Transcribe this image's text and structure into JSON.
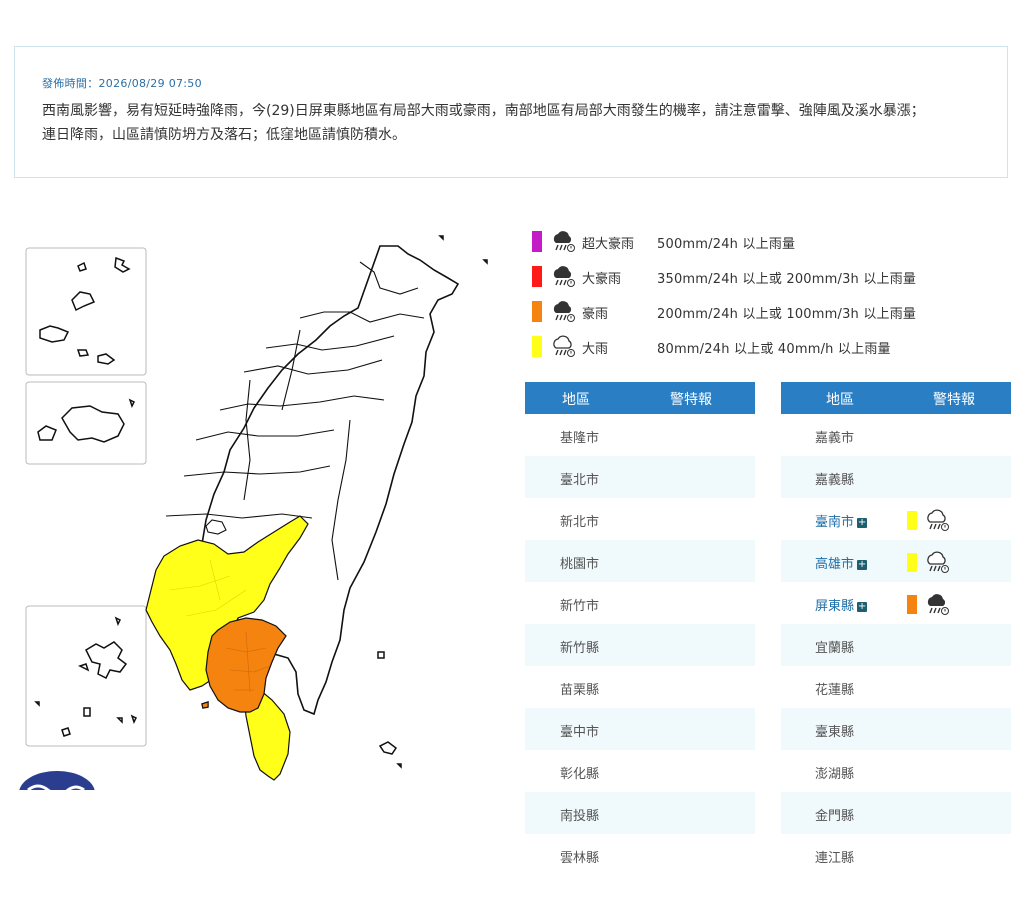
{
  "notice": {
    "time": "發佈時間：2026/08/29 07:50",
    "line1": "西南風影響，易有短延時強降雨，今(29)日屏東縣地區有局部大雨或豪雨，南部地區有局部大雨發生的機率，請注意雷擊、強陣風及溪水暴漲；",
    "line2": "連日降雨，山區請慎防坍方及落石；低窪地區請慎防積水。"
  },
  "colors": {
    "extreme": "#c21bc7",
    "torrential": "#ff1a1a",
    "heavy_torrential": "#f5830f",
    "heavy": "#ffff1a",
    "header": "#2a7fc4",
    "alt_row": "#f0f9fc"
  },
  "legend": [
    {
      "name": "超大豪雨",
      "desc": "500mm/24h 以上雨量",
      "color": "#c21bc7",
      "icon": "storm-rain-dark-icon"
    },
    {
      "name": "大豪雨",
      "desc": "350mm/24h 以上或 200mm/3h 以上雨量",
      "color": "#ff1a1a",
      "icon": "storm-rain-dark-icon"
    },
    {
      "name": "豪雨",
      "desc": "200mm/24h 以上或 100mm/3h 以上雨量",
      "color": "#f5830f",
      "icon": "storm-rain-dark-icon"
    },
    {
      "name": "大雨",
      "desc": "80mm/24h 以上或 40mm/h 以上雨量",
      "color": "#ffff1a",
      "icon": "rain-outline-icon"
    }
  ],
  "table": {
    "col_region": "地區",
    "col_warning": "警特報",
    "left": [
      {
        "region": "基隆市"
      },
      {
        "region": "臺北市"
      },
      {
        "region": "新北市"
      },
      {
        "region": "桃園市"
      },
      {
        "region": "新竹市"
      },
      {
        "region": "新竹縣"
      },
      {
        "region": "苗栗縣"
      },
      {
        "region": "臺中市"
      },
      {
        "region": "彰化縣"
      },
      {
        "region": "南投縣"
      },
      {
        "region": "雲林縣"
      }
    ],
    "right": [
      {
        "region": "嘉義市"
      },
      {
        "region": "嘉義縣"
      },
      {
        "region": "臺南市",
        "level": "heavy"
      },
      {
        "region": "高雄市",
        "level": "heavy"
      },
      {
        "region": "屏東縣",
        "level": "heavy_torrential"
      },
      {
        "region": "宜蘭縣"
      },
      {
        "region": "花蓮縣"
      },
      {
        "region": "臺東縣"
      },
      {
        "region": "澎湖縣"
      },
      {
        "region": "金門縣"
      },
      {
        "region": "連江縣"
      }
    ]
  }
}
